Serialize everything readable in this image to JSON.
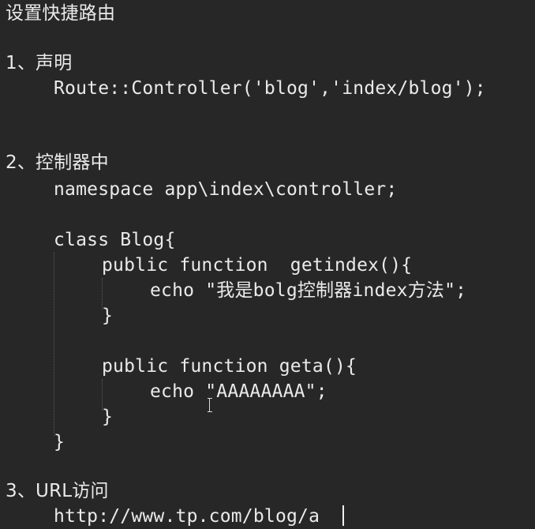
{
  "doc": {
    "title": "设置快捷路由",
    "section1": {
      "heading": "1、声明",
      "code": "Route::Controller('blog','index/blog');"
    },
    "section2": {
      "heading": "2、控制器中",
      "namespace": "namespace app\\index\\controller;",
      "class_open": "class Blog{",
      "method1_sig": "public function  getindex(){",
      "method1_body": "echo \"我是bolg控制器index方法\";",
      "method1_close": "}",
      "method2_sig": "public function geta(){",
      "method2_body": "echo \"AAAAAAAA\";",
      "method2_close": "}",
      "class_close": "}"
    },
    "section3": {
      "heading": "3、URL访问",
      "url": "http://www.tp.com/blog/a"
    }
  },
  "theme": {
    "background": "#272727",
    "text": "#eaeaea",
    "indent_guide": "#5a5a58"
  }
}
